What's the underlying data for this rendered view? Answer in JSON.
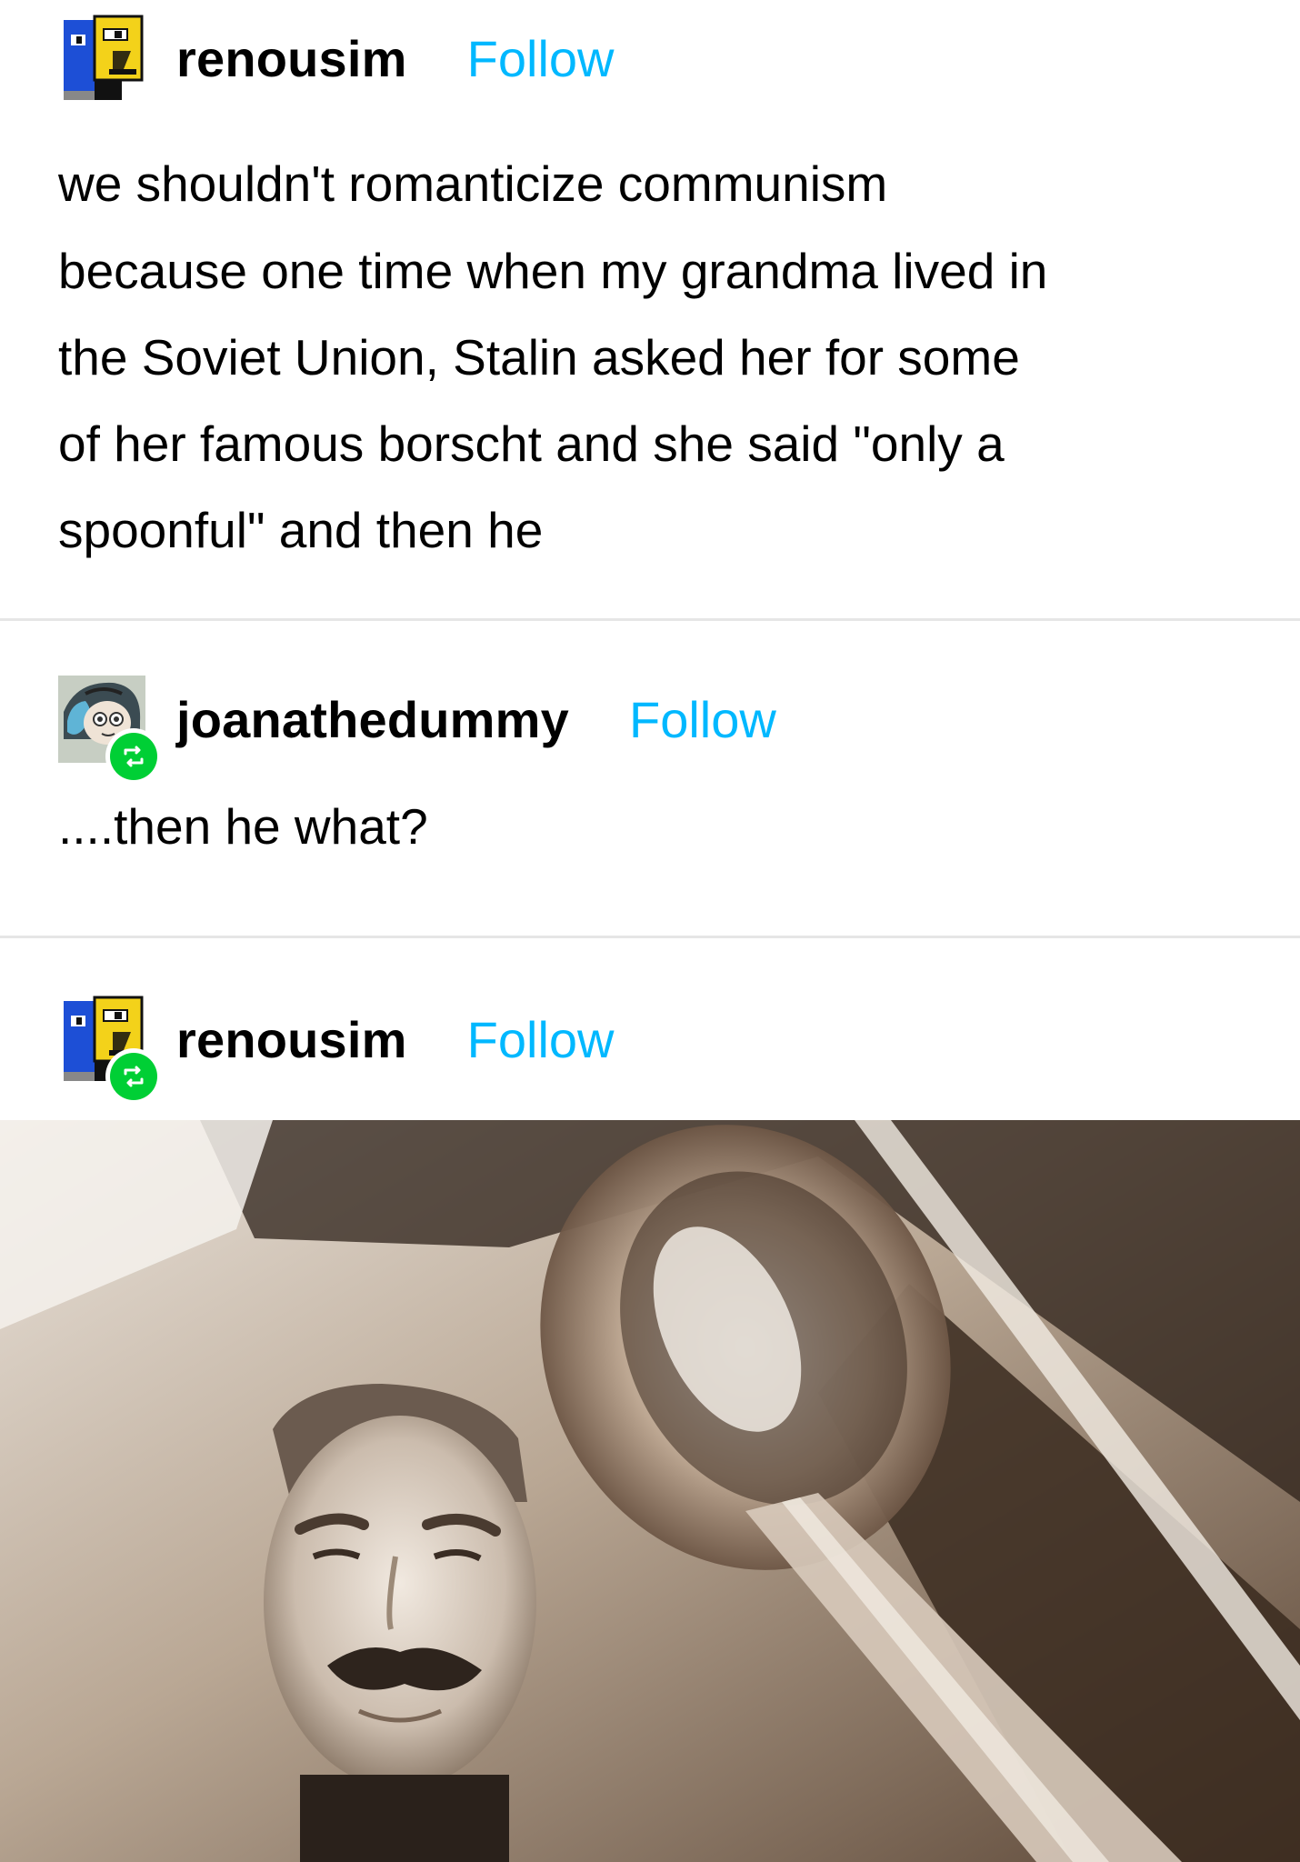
{
  "posts": [
    {
      "username": "renousim",
      "follow_label": "Follow",
      "avatar_icon": "blocky-face-avatar-icon",
      "reblogged": false,
      "body_lines": [
        "we shouldn't romanticize communism",
        "because one time when my grandma lived in",
        "the Soviet Union, Stalin asked her for some",
        "of her famous borscht and she said \"only a",
        "spoonful\" and then he"
      ]
    },
    {
      "username": "joanathedummy",
      "follow_label": "Follow",
      "avatar_icon": "anime-character-avatar-icon",
      "reblogged": true,
      "body_lines": [
        "....then he what?"
      ]
    },
    {
      "username": "renousim",
      "follow_label": "Follow",
      "avatar_icon": "blocky-face-avatar-icon",
      "reblogged": true,
      "image": "sepia-photo-stalin-face-with-giant-spoon"
    }
  ],
  "colors": {
    "follow": "#00b8ff",
    "reblog_badge": "#00cf35",
    "divider": "#e6e6e6",
    "text": "#000000"
  }
}
